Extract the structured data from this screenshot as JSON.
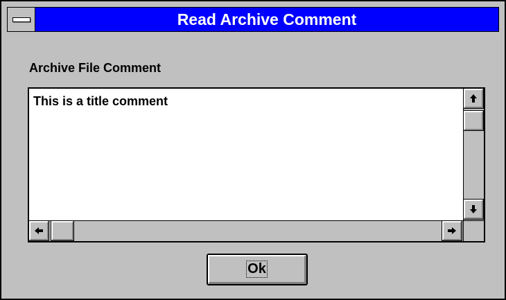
{
  "window": {
    "title": "Read Archive Comment",
    "title_bar_color": "#0000ff",
    "background_color": "#c0c0c0"
  },
  "system_menu": {
    "icon": "system-menu-icon"
  },
  "comment": {
    "label": "Archive File Comment",
    "text": "This is a title comment"
  },
  "scrollbars": {
    "vertical": {
      "up_icon": "arrow-up-icon",
      "down_icon": "arrow-down-icon",
      "up_glyph": "🠉",
      "down_glyph": "🠋"
    },
    "horizontal": {
      "left_icon": "arrow-left-icon",
      "right_icon": "arrow-right-icon",
      "left_glyph": "🠈",
      "right_glyph": "🠊"
    }
  },
  "buttons": {
    "ok_label": "Ok"
  }
}
